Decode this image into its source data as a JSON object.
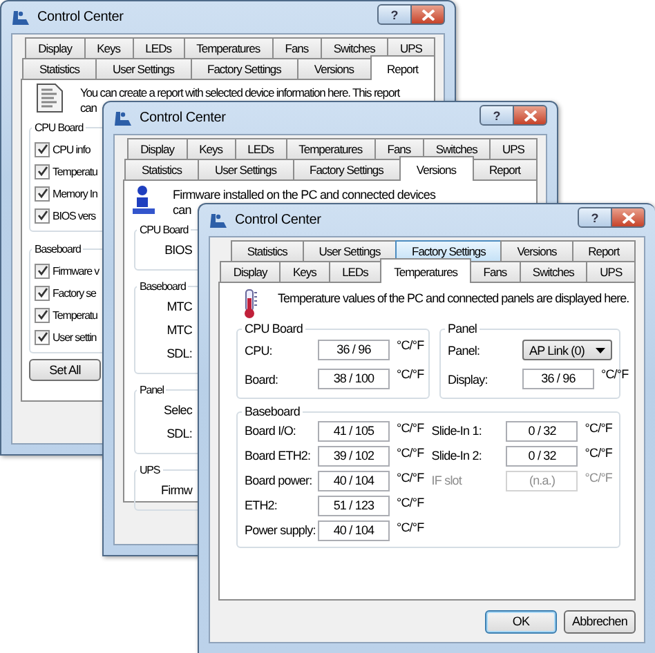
{
  "windows": [
    {
      "kind": "report",
      "title": "Control Center",
      "help_button": "?",
      "tab_rows": [
        [
          {
            "label": "Display",
            "selected": false,
            "highlighted": false
          },
          {
            "label": "Keys",
            "selected": false,
            "highlighted": false
          },
          {
            "label": "LEDs",
            "selected": false,
            "highlighted": false
          },
          {
            "label": "Temperatures",
            "selected": false,
            "highlighted": false
          },
          {
            "label": "Fans",
            "selected": false,
            "highlighted": false
          },
          {
            "label": "Switches",
            "selected": false,
            "highlighted": false
          },
          {
            "label": "UPS",
            "selected": false,
            "highlighted": false
          }
        ],
        [
          {
            "label": "Statistics",
            "selected": false,
            "highlighted": false
          },
          {
            "label": "User Settings",
            "selected": false,
            "highlighted": false
          },
          {
            "label": "Factory Settings",
            "selected": false,
            "highlighted": false
          },
          {
            "label": "Versions",
            "selected": false,
            "highlighted": false
          },
          {
            "label": "Report",
            "selected": true,
            "highlighted": false
          }
        ]
      ],
      "intro": [
        "You can create a report with selected device information here. This report",
        "can"
      ],
      "groups": [
        {
          "title": "CPU Board",
          "items": [
            {
              "label": "CPU info",
              "checked": true
            },
            {
              "label": "Temperatu",
              "checked": true
            },
            {
              "label": "Memory In",
              "checked": true
            },
            {
              "label": "BIOS vers",
              "checked": true
            }
          ]
        },
        {
          "title": "Baseboard",
          "items": [
            {
              "label": "Firmware v",
              "checked": true
            },
            {
              "label": "Factory se",
              "checked": true
            },
            {
              "label": "Temperatu",
              "checked": true
            },
            {
              "label": "User settin",
              "checked": true
            }
          ]
        }
      ],
      "button": "Set All"
    },
    {
      "kind": "versions",
      "title": "Control Center",
      "help_button": "?",
      "tab_rows": [
        [
          {
            "label": "Display",
            "selected": false,
            "highlighted": false
          },
          {
            "label": "Keys",
            "selected": false,
            "highlighted": false
          },
          {
            "label": "LEDs",
            "selected": false,
            "highlighted": false
          },
          {
            "label": "Temperatures",
            "selected": false,
            "highlighted": false
          },
          {
            "label": "Fans",
            "selected": false,
            "highlighted": false
          },
          {
            "label": "Switches",
            "selected": false,
            "highlighted": false
          },
          {
            "label": "UPS",
            "selected": false,
            "highlighted": false
          }
        ],
        [
          {
            "label": "Statistics",
            "selected": false,
            "highlighted": false
          },
          {
            "label": "User Settings",
            "selected": false,
            "highlighted": false
          },
          {
            "label": "Factory Settings",
            "selected": false,
            "highlighted": false
          },
          {
            "label": "Versions",
            "selected": true,
            "highlighted": false
          },
          {
            "label": "Report",
            "selected": false,
            "highlighted": false
          }
        ]
      ],
      "intro": [
        "Firmware installed on the PC and connected devices",
        "can"
      ],
      "groups": [
        {
          "title": "CPU Board",
          "labels": [
            "BIOS"
          ]
        },
        {
          "title": "Baseboard",
          "labels": [
            "MTC",
            "MTC",
            "SDL:"
          ]
        },
        {
          "title": "Panel",
          "labels": [
            "Selec",
            "SDL:"
          ]
        },
        {
          "title": "UPS",
          "labels": [
            "Firmw"
          ]
        }
      ]
    },
    {
      "kind": "temperatures",
      "title": "Control Center",
      "help_button": "?",
      "tab_rows": [
        [
          {
            "label": "Statistics",
            "selected": false,
            "highlighted": false
          },
          {
            "label": "User Settings",
            "selected": false,
            "highlighted": false
          },
          {
            "label": "Factory Settings",
            "selected": false,
            "highlighted": true
          },
          {
            "label": "Versions",
            "selected": false,
            "highlighted": false
          },
          {
            "label": "Report",
            "selected": false,
            "highlighted": false
          }
        ],
        [
          {
            "label": "Display",
            "selected": false,
            "highlighted": false
          },
          {
            "label": "Keys",
            "selected": false,
            "highlighted": false
          },
          {
            "label": "LEDs",
            "selected": false,
            "highlighted": false
          },
          {
            "label": "Temperatures",
            "selected": true,
            "highlighted": false
          },
          {
            "label": "Fans",
            "selected": false,
            "highlighted": false
          },
          {
            "label": "Switches",
            "selected": false,
            "highlighted": false
          },
          {
            "label": "UPS",
            "selected": false,
            "highlighted": false
          }
        ]
      ],
      "intro": "Temperature values of the PC and connected panels are displayed here.",
      "cpu_board": {
        "title": "CPU Board",
        "rows": [
          {
            "label": "CPU:",
            "value": "36 / 96",
            "unit": "°C/°F",
            "disabled": false
          },
          {
            "label": "Board:",
            "value": "38 / 100",
            "unit": "°C/°F",
            "disabled": false
          }
        ]
      },
      "panel": {
        "title": "Panel",
        "selector": {
          "label": "Panel:",
          "value": "AP Link (0)"
        },
        "rows": [
          {
            "label": "Display:",
            "value": "36 / 96",
            "unit": "°C/°F",
            "disabled": false
          }
        ]
      },
      "baseboard": {
        "title": "Baseboard",
        "columns": [
          [
            {
              "label": "Board I/O:",
              "value": "41 / 105",
              "unit": "°C/°F",
              "disabled": false
            },
            {
              "label": "Board ETH2:",
              "value": "39 / 102",
              "unit": "°C/°F",
              "disabled": false
            },
            {
              "label": "Board power:",
              "value": "40 / 104",
              "unit": "°C/°F",
              "disabled": false
            },
            {
              "label": "ETH2:",
              "value": "51 / 123",
              "unit": "°C/°F",
              "disabled": false
            },
            {
              "label": "Power supply:",
              "value": "40 / 104",
              "unit": "°C/°F",
              "disabled": false
            }
          ],
          [
            {
              "label": "Slide-In 1:",
              "value": "0 / 32",
              "unit": "°C/°F",
              "disabled": false
            },
            {
              "label": "Slide-In 2:",
              "value": "0 / 32",
              "unit": "°C/°F",
              "disabled": false
            },
            {
              "label": "IF slot",
              "value": "(n.a.)",
              "unit": "°C/°F",
              "disabled": true
            }
          ]
        ]
      },
      "buttons": [
        {
          "label": "OK",
          "default": true
        },
        {
          "label": "Abbrechen",
          "default": false
        }
      ]
    }
  ]
}
